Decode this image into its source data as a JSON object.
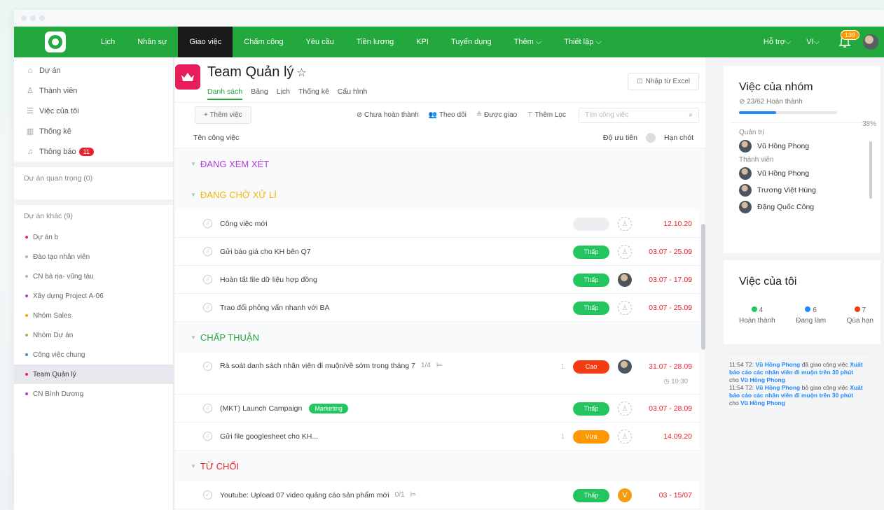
{
  "colors": {
    "brand_green": "#22a83d",
    "active_nav": "#1a1a1a",
    "danger": "#e8232f",
    "priority_low": "#22c55e",
    "priority_high": "#f23c11",
    "priority_urgent": "#ff9800"
  },
  "nav": {
    "items": [
      "Lịch",
      "Nhân sự",
      "Giao việc",
      "Chấm công",
      "Yêu cầu",
      "Tiền lương",
      "KPI",
      "Tuyển dụng",
      "Thêm ⌵",
      "Thiết lập ⌵"
    ],
    "active_index": 2,
    "support": "Hỗ trợ⌵",
    "lang": "VI⌵",
    "notif_count": "139"
  },
  "sidebar": {
    "items": [
      {
        "icon": "home-icon",
        "label": "Dự án"
      },
      {
        "icon": "user-icon",
        "label": "Thành viên"
      },
      {
        "icon": "list-icon",
        "label": "Việc của tôi"
      },
      {
        "icon": "chart-icon",
        "label": "Thống kê"
      },
      {
        "icon": "bell-icon",
        "label": "Thông báo",
        "badge": "11"
      }
    ],
    "important_section": "Dự án quan trọng (0)",
    "other_section": "Dự án khác (9)",
    "projects": [
      {
        "label": "Dự án b",
        "color": "#e81e8c"
      },
      {
        "label": "Đào tạo nhân viên",
        "color": "#b0b3b8"
      },
      {
        "label": "CN bà rịa- vũng tàu",
        "color": "#b0b3b8"
      },
      {
        "label": "Xây dựng Project A-06",
        "color": "#b23bd9"
      },
      {
        "label": "Nhóm Sales",
        "color": "#f39c12"
      },
      {
        "label": "Nhóm Dự án",
        "color": "#8bc34a"
      },
      {
        "label": "Công việc chung",
        "color": "#3c8dbc"
      },
      {
        "label": "Team Quản lý",
        "color": "#e81e5a",
        "active": true
      },
      {
        "label": "CN Bình Dương",
        "color": "#b23bd9"
      }
    ]
  },
  "project": {
    "title": "Team Quản lý",
    "tabs": [
      "Danh sách",
      "Bảng",
      "Lịch",
      "Thống kê",
      "Cấu hình"
    ],
    "excel_button": "Nhập từ Excel",
    "add_task": "+ Thêm việc",
    "filter_incomplete": "Chưa hoàn thành",
    "filter_following": "Theo dõi",
    "filter_assigned": "Được giao",
    "filter_more": "Thêm Lọc",
    "search_placeholder": "Tìm công việc",
    "col_task": "Tên công việc",
    "col_priority": "Độ ưu tiên",
    "col_deadline": "Hạn chót"
  },
  "groups": [
    {
      "name": "ĐANG XEM XÉT",
      "color": "#b23bd9",
      "tasks": []
    },
    {
      "name": "ĐANG CHỜ XỬ LÍ",
      "color": "#f5b400",
      "tasks": [
        {
          "name": "Công việc mới",
          "priority": "",
          "pclass": "p-empty",
          "assignee": "empty",
          "deadline": "12.10.20"
        },
        {
          "name": "Gửi báo giá cho KH bên Q7",
          "priority": "Thấp",
          "pclass": "p-green",
          "assignee": "empty",
          "deadline": "03.07 - 25.09"
        },
        {
          "name": "Hoàn tất file dữ liệu hợp đồng",
          "priority": "Thấp",
          "pclass": "p-green",
          "assignee": "photo",
          "deadline": "03.07 - 17.09"
        },
        {
          "name": "Trao đổi phỏng vấn nhanh với BA",
          "priority": "Thấp",
          "pclass": "p-green",
          "assignee": "empty",
          "deadline": "03.07 - 25.09"
        }
      ]
    },
    {
      "name": "CHẤP THUẬN",
      "color": "#22a83d",
      "tasks": [
        {
          "name": "Rà soát danh sách nhân viên đi muộn/về sớm trong tháng 7",
          "meta": "1/4",
          "count": "1",
          "priority": "Cao",
          "pclass": "p-red",
          "assignee": "photo",
          "deadline": "31.07 - 28.09",
          "time": "10:30"
        },
        {
          "name": "(MKT) Launch Campaign",
          "tag": "Marketing",
          "priority": "Thấp",
          "pclass": "p-green",
          "assignee": "empty",
          "deadline": "03.07 - 28.09"
        },
        {
          "name": "Gửi file googlesheet cho KH...",
          "count": "1",
          "priority": "Vừa",
          "pclass": "p-orange",
          "assignee": "empty",
          "deadline": "14.09.20"
        }
      ]
    },
    {
      "name": "TỪ CHỐI",
      "color": "#e8232f",
      "tasks": [
        {
          "name": "Youtube: Upload 07 video quảng cáo sản phẩm mới",
          "meta": "0/1",
          "priority": "Thấp",
          "pclass": "p-green",
          "assignee": "letter",
          "letter": "V",
          "deadline": "03 - 15/07"
        }
      ]
    }
  ],
  "team_panel": {
    "title": "Việc của nhóm",
    "done": "23/62 Hoàn thành",
    "progress_pct": 38,
    "pct_label": "38%",
    "admin_label": "Quản trị",
    "admins": [
      "Vũ Hồng Phong"
    ],
    "member_label": "Thành viên",
    "members": [
      "Vũ Hồng Phong",
      "Trương Việt Hùng",
      "Đặng Quốc Công"
    ]
  },
  "my_panel": {
    "title": "Việc của tôi",
    "stats": [
      {
        "n": "4",
        "label": "Hoàn thành",
        "color": "#22c55e"
      },
      {
        "n": "6",
        "label": "Đang làm",
        "color": "#2188ff"
      },
      {
        "n": "7",
        "label": "Qúa hạn",
        "color": "#f23c11"
      }
    ]
  },
  "feed": [
    {
      "time": "11:54 T2:",
      "user": "Vũ Hồng Phong",
      "verb": "đã giao công việc",
      "task": "Xuất báo cáo các nhân viên đi muộn trên 30 phút",
      "to": "cho",
      "target": "Vũ Hồng Phong"
    },
    {
      "time": "11:54 T2:",
      "user": "Vũ Hồng Phong",
      "verb": "bỏ giao công việc",
      "task": "Xuất báo cáo các nhân viên đi muộn trên 30 phút",
      "to": "cho",
      "target": "Vũ Hồng Phong"
    }
  ]
}
